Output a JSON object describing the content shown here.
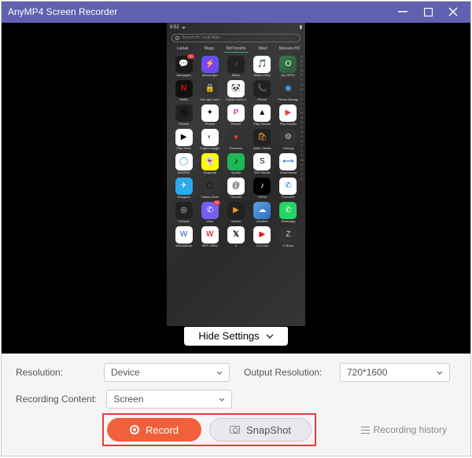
{
  "titlebar": {
    "title": "AnyMP4 Screen Recorder"
  },
  "statusbar": {
    "time": "9:52"
  },
  "search": {
    "placeholder": "Search for Local Apps"
  },
  "categories": [
    "Lublak",
    "Maps",
    "McDonalds",
    "Meet",
    "Messen-HD"
  ],
  "alphaindex": [
    "A",
    "B",
    "C",
    "D",
    "E",
    "F",
    "G",
    "H",
    "I",
    "J",
    "K",
    "L",
    "M",
    "N",
    "O",
    "P",
    "Q",
    "R",
    "S",
    "T",
    "U",
    "V",
    "W",
    "X",
    "Y",
    "Z",
    "#"
  ],
  "apps": [
    {
      "label": "Messages",
      "glyph": "💬",
      "cls": "ic-messages",
      "badge": "70"
    },
    {
      "label": "Messenger",
      "glyph": "⚡",
      "cls": "ic-messenger"
    },
    {
      "label": "Music",
      "glyph": "♪",
      "cls": "ic-music"
    },
    {
      "label": "Music Party",
      "glyph": "🎵",
      "cls": "ic-musicparty"
    },
    {
      "label": "My OPPO",
      "glyph": "O",
      "cls": "ic-myoppo"
    },
    {
      "label": "Netflix",
      "glyph": "N",
      "cls": "ic-netflix"
    },
    {
      "label": "One-tap Lock Screen",
      "glyph": "🔒",
      "cls": "ic-lockscreen"
    },
    {
      "label": "Panda Video Compressor",
      "glyph": "🐼",
      "cls": "ic-panda"
    },
    {
      "label": "Phone",
      "glyph": "📞",
      "cls": "ic-phone"
    },
    {
      "label": "Phone Manager",
      "glyph": "◉",
      "cls": "ic-phonemanager"
    },
    {
      "label": "Photos",
      "glyph": "🖼",
      "cls": "ic-photos"
    },
    {
      "label": "Photos",
      "glyph": "✦",
      "cls": "ic-gphotos"
    },
    {
      "label": "Picsart",
      "glyph": "P",
      "cls": "ic-picsart"
    },
    {
      "label": "Play Games",
      "glyph": "▲",
      "cls": "ic-playgames"
    },
    {
      "label": "Play Movies",
      "glyph": "▶",
      "cls": "ic-playmovies"
    },
    {
      "label": "Play Store",
      "glyph": "▶",
      "cls": "ic-playstore"
    },
    {
      "label": "Project Insight",
      "glyph": "◐",
      "cls": "ic-insight"
    },
    {
      "label": "Recorder",
      "glyph": "●",
      "cls": "ic-recorder"
    },
    {
      "label": "Seller Center",
      "glyph": "🛍",
      "cls": "ic-seller"
    },
    {
      "label": "Settings",
      "glyph": "⚙",
      "cls": "ic-settings"
    },
    {
      "label": "SHAREit",
      "glyph": "◯",
      "cls": "ic-shareit"
    },
    {
      "label": "Snapchat",
      "glyph": "👻",
      "cls": "ic-snapchat"
    },
    {
      "label": "Spotify",
      "glyph": "♪",
      "cls": "ic-spotify"
    },
    {
      "label": "SSS Mobile",
      "glyph": "S",
      "cls": "ic-iss"
    },
    {
      "label": "TeamViewer",
      "glyph": "⟷",
      "cls": "ic-teamviewer"
    },
    {
      "label": "Telegram",
      "glyph": "✈",
      "cls": "ic-telegram"
    },
    {
      "label": "Theme Store",
      "glyph": "▢",
      "cls": "ic-themestore"
    },
    {
      "label": "Threads",
      "glyph": "@",
      "cls": "ic-threads"
    },
    {
      "label": "TikTok",
      "glyph": "♪",
      "cls": "ic-tiktok"
    },
    {
      "label": "Truecaller",
      "glyph": "✆",
      "cls": "ic-truecaller"
    },
    {
      "label": "UniNote",
      "glyph": "◎",
      "cls": "ic-uninote"
    },
    {
      "label": "Viber",
      "glyph": "✆",
      "cls": "ic-viber",
      "badge": "18"
    },
    {
      "label": "Videos",
      "glyph": "▶",
      "cls": "ic-videos"
    },
    {
      "label": "Weather",
      "glyph": "☁",
      "cls": "ic-weather"
    },
    {
      "label": "WhatsApp",
      "glyph": "✆",
      "cls": "ic-whatsapp"
    },
    {
      "label": "WordsBook",
      "glyph": "W",
      "cls": "ic-word"
    },
    {
      "label": "WPS Office",
      "glyph": "W",
      "cls": "ic-wps"
    },
    {
      "label": "X",
      "glyph": "𝕏",
      "cls": "ic-x"
    },
    {
      "label": "YouTube",
      "glyph": "▶",
      "cls": "ic-youtube"
    },
    {
      "label": "Z Music",
      "glyph": "Z",
      "cls": "ic-zmusic"
    }
  ],
  "hideSettings": {
    "label": "Hide Settings"
  },
  "settings": {
    "resolution_label": "Resolution:",
    "resolution_value": "Device",
    "output_label": "Output Resolution:",
    "output_value": "720*1600",
    "content_label": "Recording Content:",
    "content_value": "Screen"
  },
  "actions": {
    "record": "Record",
    "snapshot": "SnapShot",
    "history": "Recording history"
  }
}
